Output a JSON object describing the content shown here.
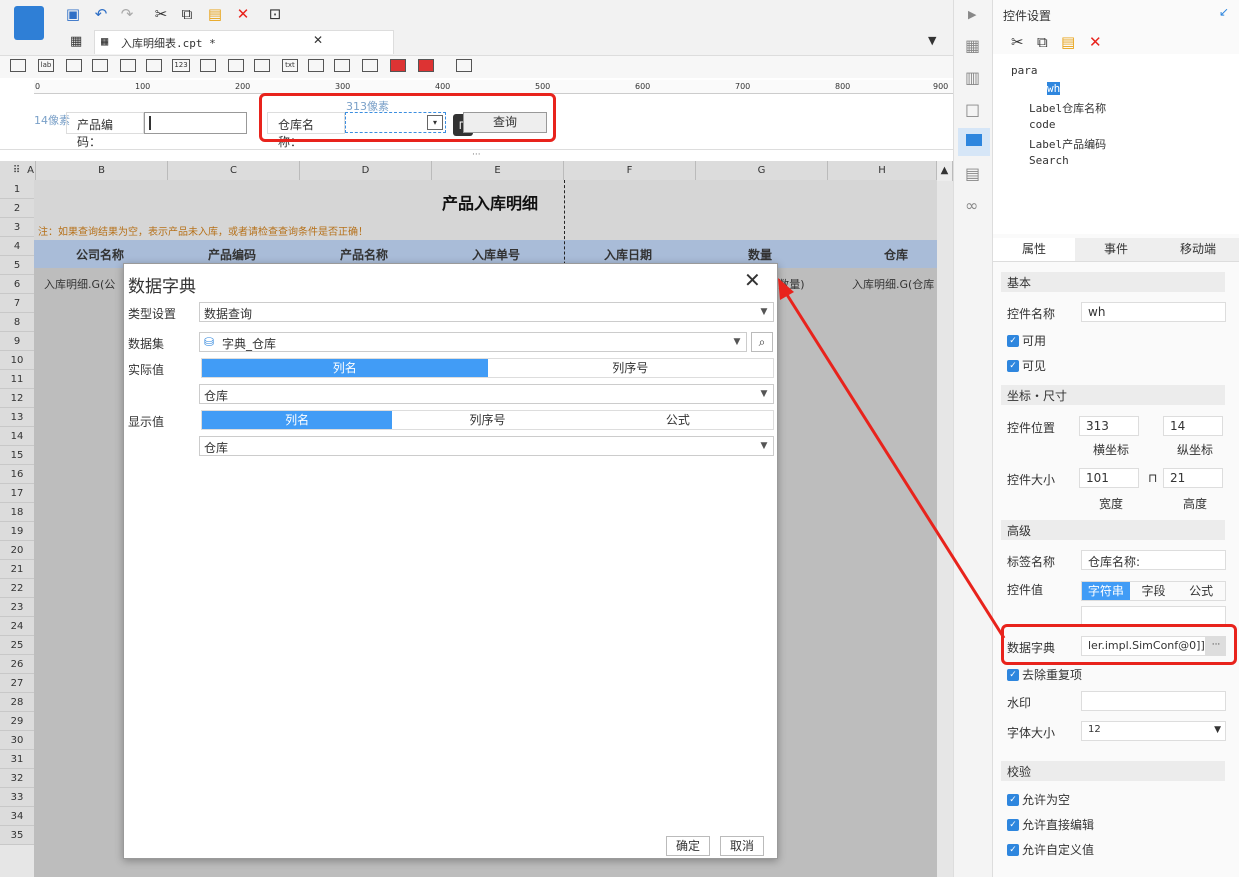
{
  "toolbar": {
    "tab_label": "入库明细表.cpt *"
  },
  "widgets": [
    "lab",
    "123",
    "txt"
  ],
  "ruler_ticks": [
    "0",
    "100",
    "200",
    "300",
    "400",
    "500",
    "600",
    "700",
    "800",
    "900"
  ],
  "param": {
    "px_hint_left": "14像素",
    "px_hint_top": "313像素",
    "product_code_label": "产品编码：",
    "warehouse_label": "仓库名称：",
    "query_button": "查询"
  },
  "columns": [
    "A",
    "B",
    "C",
    "D",
    "E",
    "F",
    "G",
    "H"
  ],
  "rows": [
    "1",
    "2",
    "3",
    "4",
    "5",
    "6",
    "7",
    "8",
    "9",
    "10",
    "11",
    "12",
    "13",
    "14",
    "15",
    "16",
    "17",
    "18",
    "19",
    "20",
    "21",
    "22",
    "23",
    "24",
    "25",
    "26",
    "27",
    "28",
    "29",
    "30",
    "31",
    "32",
    "33",
    "34",
    "35"
  ],
  "sheet": {
    "title": "产品入库明细",
    "note": "注：如果查询结果为空，表示产品未入库，或者请检查查询条件是否正确！",
    "headers": [
      "公司名称",
      "产品编码",
      "产品名称",
      "入库单号",
      "入库日期",
      "数量",
      "仓库"
    ],
    "row5_left": "入库明细.G(公",
    "row5_mid": "(数量)",
    "row5_right": "入库明细.G(仓库"
  },
  "dialog": {
    "title": "数据字典",
    "type_label": "类型设置",
    "type_value": "数据查询",
    "dataset_label": "数据集",
    "dataset_value": "字典_仓库",
    "actual_label": "实际值",
    "actual_tabs": [
      "列名",
      "列序号"
    ],
    "actual_value": "仓库",
    "display_label": "显示值",
    "display_tabs": [
      "列名",
      "列序号",
      "公式"
    ],
    "display_value": "仓库",
    "ok": "确定",
    "cancel": "取消"
  },
  "panel": {
    "title": "控件设置",
    "tree": [
      "para",
      "wh",
      "Label仓库名称",
      "code",
      "Label产品编码",
      "Search"
    ],
    "tabs": [
      "属性",
      "事件",
      "移动端"
    ],
    "sect_basic": "基本",
    "name_label": "控件名称",
    "name_value": "wh",
    "enabled": "可用",
    "visible": "可见",
    "sect_pos": "坐标・尺寸",
    "pos_label": "控件位置",
    "x": "313",
    "y": "14",
    "x_cap": "横坐标",
    "y_cap": "纵坐标",
    "size_label": "控件大小",
    "w": "101",
    "h": "21",
    "w_cap": "宽度",
    "h_cap": "高度",
    "sect_adv": "高级",
    "tag_label": "标签名称",
    "tag_value": "仓库名称:",
    "val_label": "控件值",
    "val_tabs": [
      "字符串",
      "字段",
      "公式"
    ],
    "dict_label": "数据字典",
    "dict_value": "ler.impl.SimConf@0]]",
    "dict_btn": "···",
    "dedup": "去除重复项",
    "watermark": "水印",
    "font_label": "字体大小",
    "font_value": "12",
    "sect_check": "校验",
    "allow_empty": "允许为空",
    "allow_edit": "允许直接编辑",
    "allow_custom": "允许自定义值"
  },
  "colors": {
    "accent": "#419cf6",
    "highlight": "#e8231c"
  }
}
